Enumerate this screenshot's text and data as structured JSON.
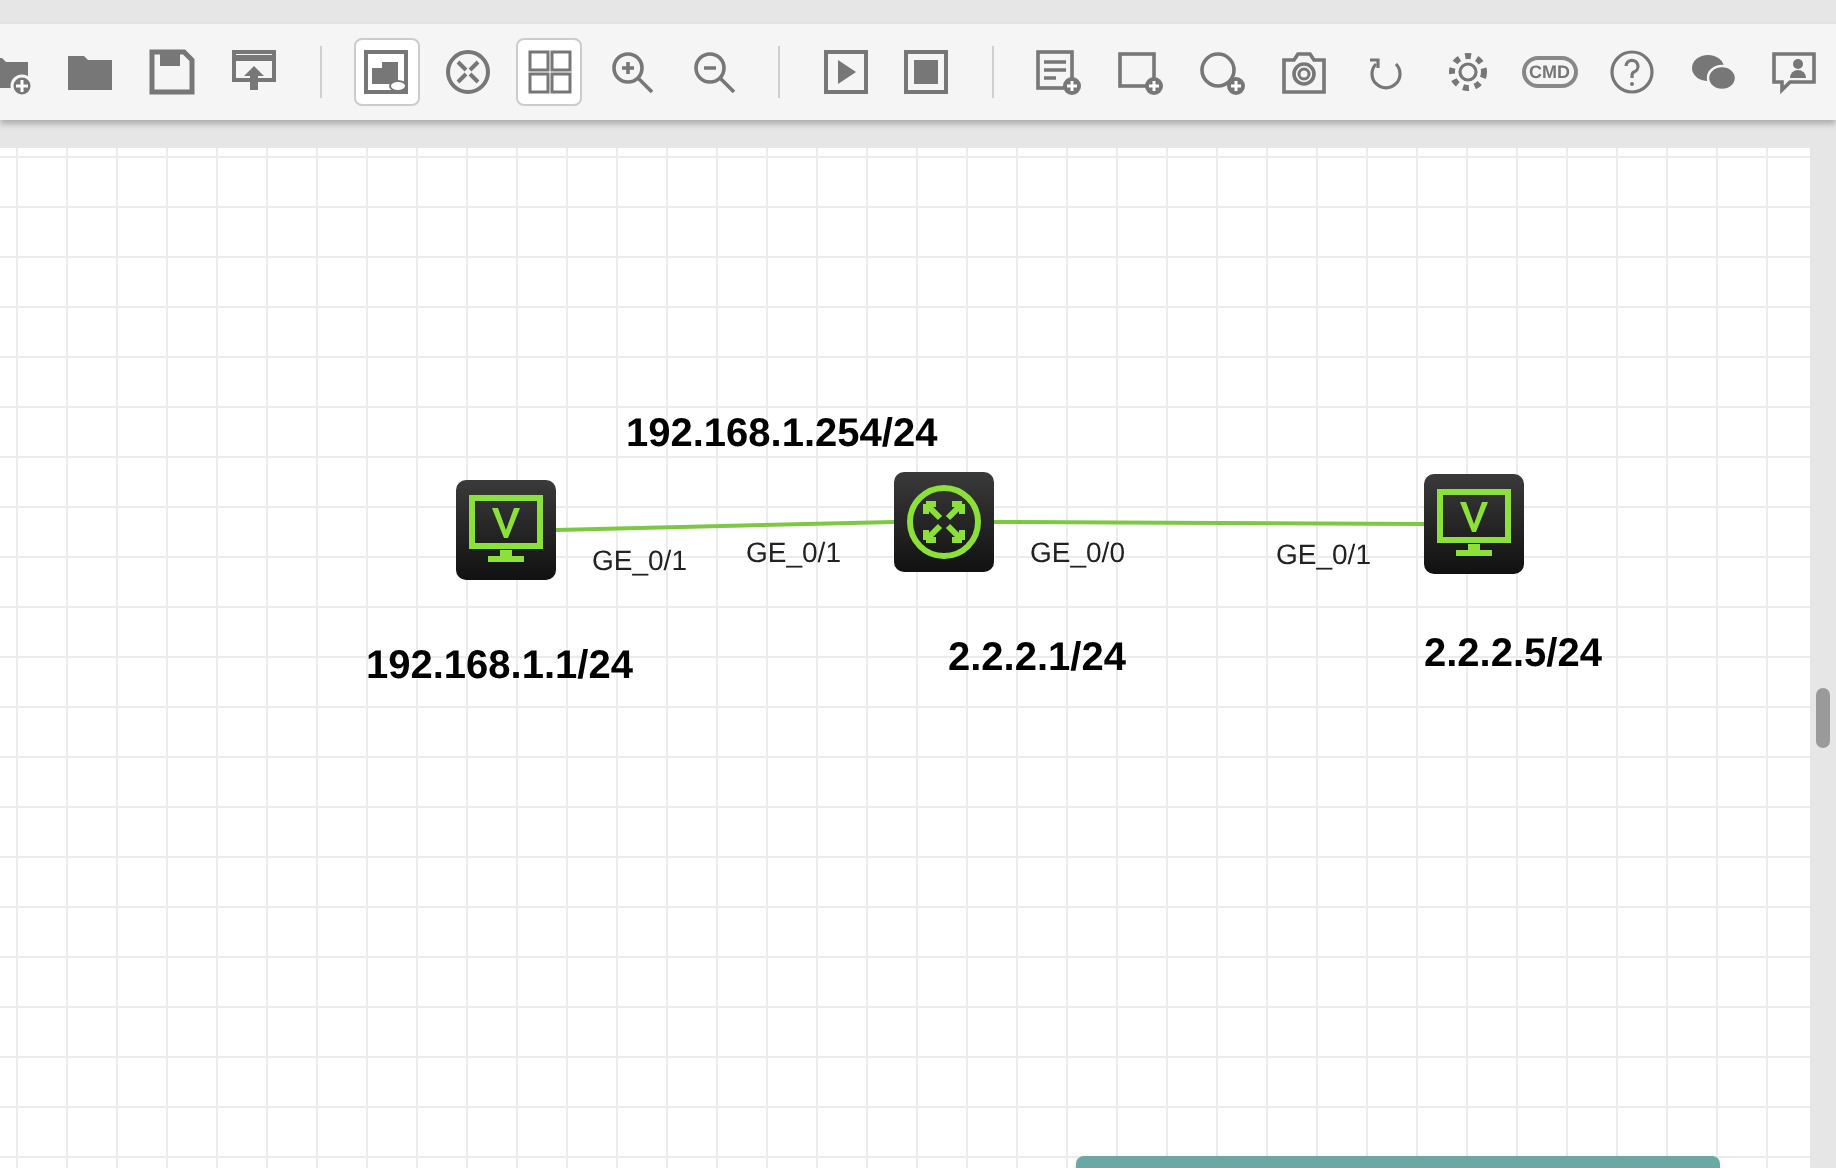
{
  "toolbar": {
    "groups": [
      [
        {
          "kind": "new-folder",
          "selected": false
        },
        {
          "kind": "folder",
          "selected": false
        },
        {
          "kind": "save",
          "selected": false
        },
        {
          "kind": "export",
          "selected": false
        }
      ],
      [
        {
          "kind": "device-view",
          "selected": true
        },
        {
          "kind": "router-view",
          "selected": false
        },
        {
          "kind": "grid",
          "selected": true
        },
        {
          "kind": "zoom-in",
          "selected": false
        },
        {
          "kind": "zoom-out",
          "selected": false
        }
      ],
      [
        {
          "kind": "play",
          "selected": false
        },
        {
          "kind": "stop",
          "selected": false
        }
      ],
      [
        {
          "kind": "add-list",
          "selected": false
        },
        {
          "kind": "add-box",
          "selected": false
        },
        {
          "kind": "add-circle",
          "selected": false
        },
        {
          "kind": "camera",
          "selected": false
        },
        {
          "kind": "refresh",
          "selected": false
        },
        {
          "kind": "settings",
          "selected": false
        },
        {
          "kind": "cmd",
          "selected": false,
          "text": "CMD"
        },
        {
          "kind": "help",
          "selected": false
        },
        {
          "kind": "chat",
          "selected": false
        },
        {
          "kind": "feedback",
          "selected": false
        }
      ]
    ]
  },
  "topology": {
    "nodes": [
      {
        "kind": "pc"
      },
      {
        "kind": "router"
      },
      {
        "kind": "pc"
      }
    ],
    "links": [
      {
        "from_port": "GE_0/1",
        "to_port": "GE_0/1"
      },
      {
        "from_port": "GE_0/0",
        "to_port": "GE_0/1"
      }
    ],
    "addresses": [
      "192.168.1.254/24",
      "192.168.1.1/24",
      "2.2.2.1/24",
      "2.2.2.5/24"
    ]
  }
}
